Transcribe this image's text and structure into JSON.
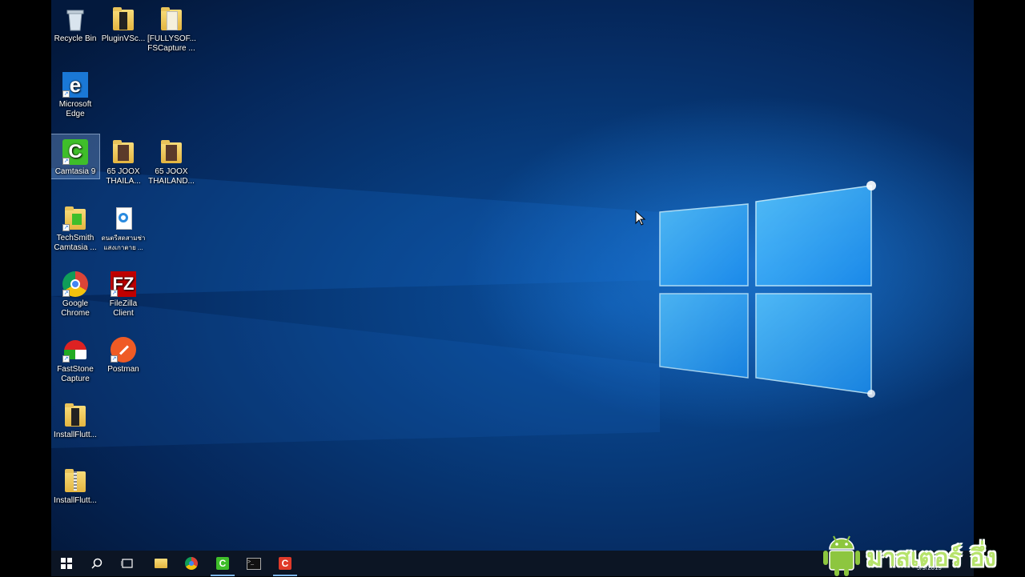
{
  "desktop": {
    "icons": [
      {
        "name": "recycle-bin",
        "label": "Recycle Bin"
      },
      {
        "name": "folder-plugin",
        "label": "PluginVSc..."
      },
      {
        "name": "folder-fullysoft",
        "label": "[FULLYSOF...\nFSCapture ..."
      },
      {
        "name": "microsoft-edge",
        "label": "Microsoft\nEdge"
      },
      {
        "name": "camtasia-9",
        "label": "Camtasia 9"
      },
      {
        "name": "folder-joox-1",
        "label": "65 JOOX\nTHAILA..."
      },
      {
        "name": "folder-joox-2",
        "label": "65 JOOX\nTHAILAND..."
      },
      {
        "name": "techsmith-camtasia",
        "label": "TechSmith\nCamtasia ..."
      },
      {
        "name": "thai-file",
        "label": "ดนตรีสดสามช่า\nแสงเกาตาย ..."
      },
      {
        "name": "google-chrome",
        "label": "Google\nChrome"
      },
      {
        "name": "filezilla-client",
        "label": "FileZilla\nClient"
      },
      {
        "name": "faststone-capture",
        "label": "FastStone\nCapture"
      },
      {
        "name": "postman",
        "label": "Postman"
      },
      {
        "name": "installflutter-1",
        "label": "InstallFlutt..."
      },
      {
        "name": "installflutter-2",
        "label": "InstallFlutt..."
      }
    ]
  },
  "taskbar": {
    "start_icon": "windows-icon",
    "search_icon": "search-icon",
    "taskview_icon": "task-view-icon",
    "apps": [
      "file-explorer",
      "google-chrome",
      "camtasia",
      "command-prompt",
      "camtasia-recorder"
    ],
    "date": "9/9/2019"
  },
  "watermark": {
    "text": "มาสเตอร์ อึ่ง"
  },
  "colors": {
    "accent": "#1e90ff",
    "taskbar": "#0c1524",
    "watermark_green": "#b6e36b"
  }
}
